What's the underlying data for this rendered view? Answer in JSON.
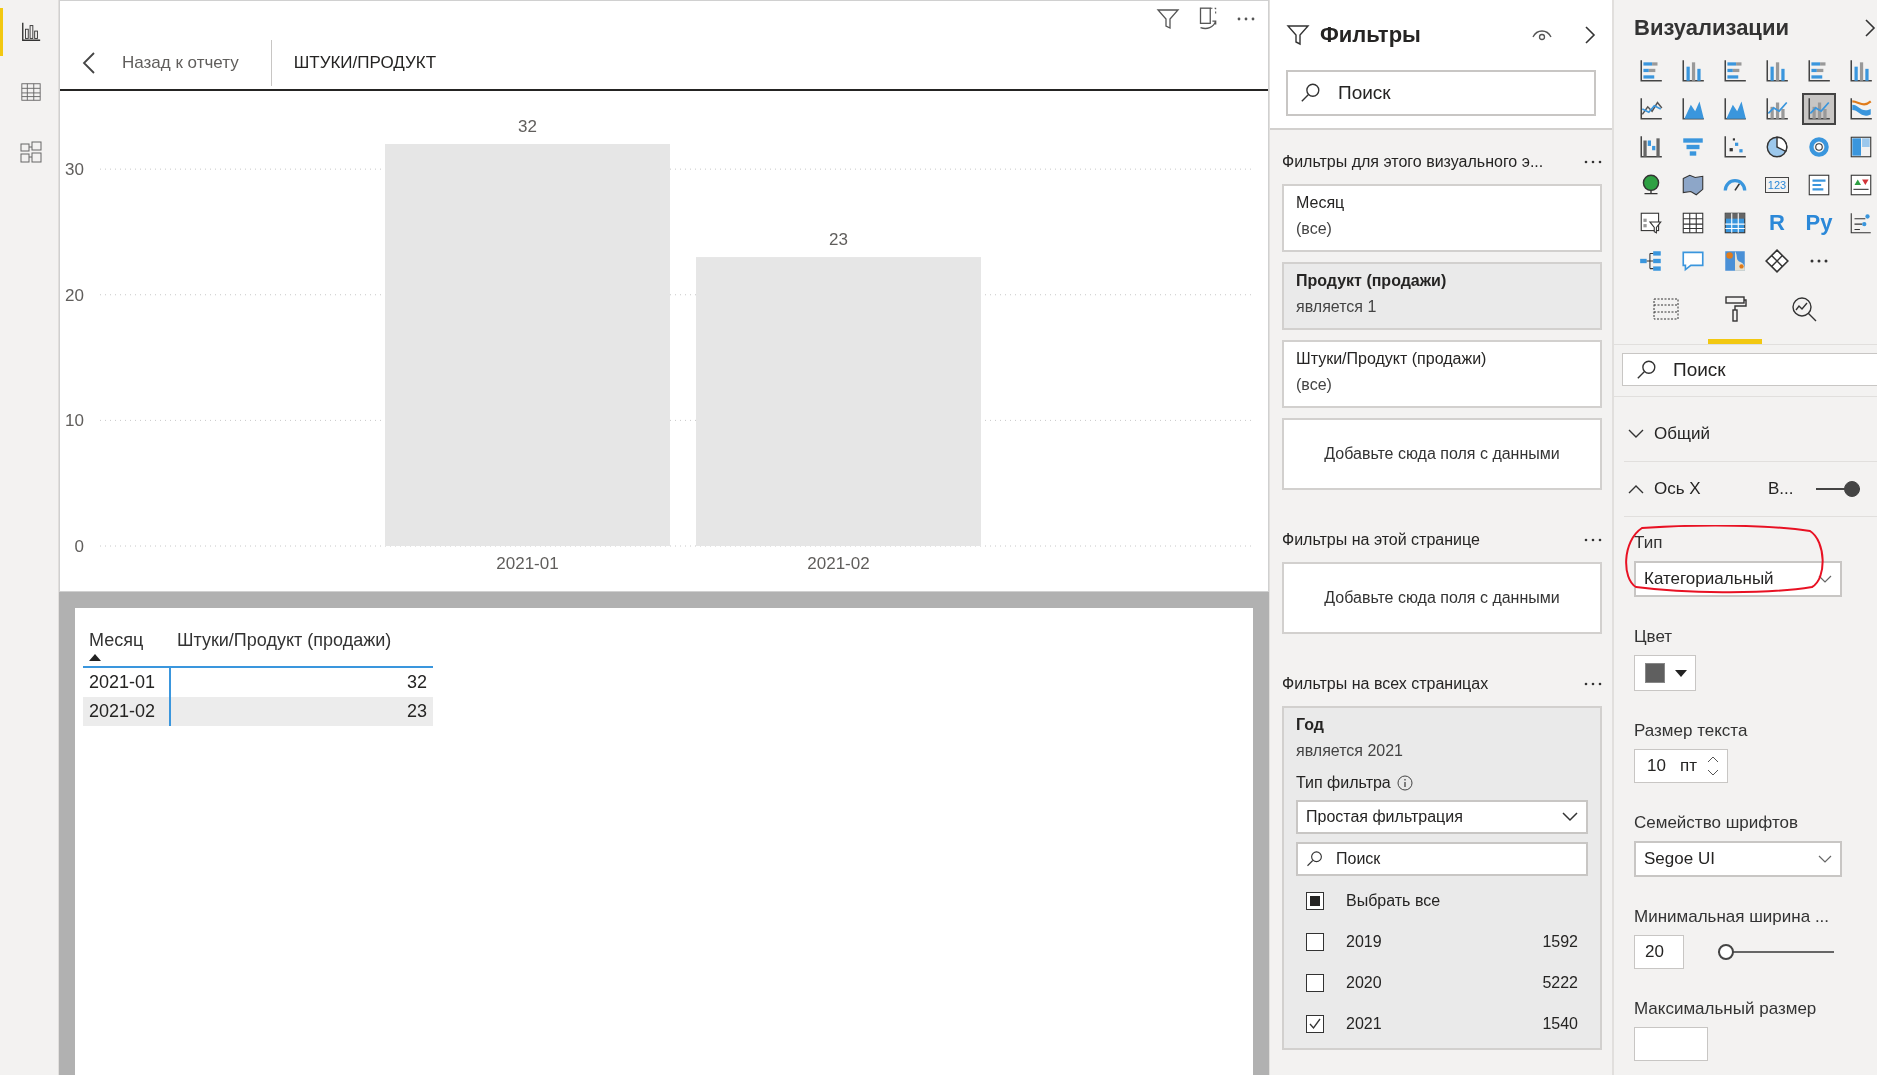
{
  "nav_rail": {
    "items": [
      {
        "selected": true
      },
      {
        "selected": false
      },
      {
        "selected": false
      }
    ]
  },
  "report": {
    "back_label": "Назад к отчету",
    "title": "ШТУКИ/ПРОДУКТ",
    "chart_data": {
      "type": "bar",
      "categories": [
        "2021-01",
        "2021-02"
      ],
      "values": [
        32,
        23
      ],
      "yticks": [
        0,
        10,
        20,
        30
      ],
      "ylim": [
        0,
        32
      ],
      "data_labels": true,
      "grid": true
    },
    "table": {
      "columns": [
        {
          "label": "Месяц",
          "sorted": true
        },
        {
          "label": "Штуки/Продукт (продажи)",
          "sorted": false
        }
      ],
      "rows": [
        [
          "2021-01",
          "32"
        ],
        [
          "2021-02",
          "23"
        ]
      ]
    }
  },
  "filters": {
    "title": "Фильтры",
    "search": {
      "placeholder": "Поиск"
    },
    "sections": [
      {
        "title": "Фильтры для этого визуального э...",
        "cards": [
          {
            "kind": "filter",
            "title": "Месяц",
            "summary": "(все)",
            "applied": false,
            "expanded": false
          },
          {
            "kind": "filter",
            "title": "Продукт (продажи)",
            "summary": "является 1",
            "applied": true,
            "expanded": false
          },
          {
            "kind": "filter",
            "title": "Штуки/Продукт (продажи)",
            "summary": "(все)",
            "applied": false,
            "expanded": false
          },
          {
            "kind": "dropzone",
            "label": "Добавьте сюда поля с данными"
          }
        ]
      },
      {
        "title": "Фильтры на этой странице",
        "cards": [
          {
            "kind": "dropzone",
            "label": "Добавьте сюда поля с данными"
          }
        ]
      },
      {
        "title": "Фильтры на всех страницах",
        "cards": [
          {
            "kind": "filter",
            "title": "Год",
            "summary": "является 2021",
            "applied": true,
            "expanded": true,
            "filter_type_label": "Тип фильтра",
            "filter_type": "Простая фильтрация",
            "search_placeholder": "Поиск",
            "items": [
              {
                "label": "Выбрать все",
                "partial": true
              },
              {
                "label": "2019",
                "count": "1592",
                "checked": false
              },
              {
                "label": "2020",
                "count": "5222",
                "checked": false
              },
              {
                "label": "2021",
                "count": "1540",
                "checked": true
              }
            ]
          }
        ]
      }
    ]
  },
  "visualizations": {
    "title": "Визуализации",
    "gallery": [
      {
        "kind": "icon",
        "selected": false
      },
      {
        "kind": "icon",
        "selected": false
      },
      {
        "kind": "icon",
        "selected": false
      },
      {
        "kind": "icon",
        "selected": false
      },
      {
        "kind": "icon",
        "selected": false
      },
      {
        "kind": "icon",
        "selected": false
      },
      {
        "kind": "icon",
        "selected": false
      },
      {
        "kind": "icon",
        "selected": false
      },
      {
        "kind": "icon",
        "selected": false
      },
      {
        "kind": "icon",
        "selected": false
      },
      {
        "kind": "icon",
        "selected": true
      },
      {
        "kind": "icon",
        "selected": false
      },
      {
        "kind": "icon",
        "selected": false
      },
      {
        "kind": "icon",
        "selected": false
      },
      {
        "kind": "icon",
        "selected": false
      },
      {
        "kind": "icon",
        "selected": false
      },
      {
        "kind": "icon",
        "selected": false
      },
      {
        "kind": "icon",
        "selected": false
      },
      {
        "kind": "icon",
        "selected": false
      },
      {
        "kind": "icon",
        "selected": false
      },
      {
        "kind": "icon",
        "selected": false
      },
      {
        "kind": "card",
        "label": "123",
        "selected": false
      },
      {
        "kind": "icon",
        "selected": false
      },
      {
        "kind": "icon",
        "selected": false
      },
      {
        "kind": "icon",
        "selected": false
      },
      {
        "kind": "icon",
        "selected": false
      },
      {
        "kind": "icon",
        "selected": false
      },
      {
        "kind": "text",
        "label": "R",
        "selected": false
      },
      {
        "kind": "text",
        "label": "Py",
        "selected": false
      },
      {
        "kind": "icon",
        "selected": false
      },
      {
        "kind": "icon",
        "selected": false
      },
      {
        "kind": "icon",
        "selected": false
      },
      {
        "kind": "icon",
        "selected": false
      },
      {
        "kind": "icon",
        "selected": false
      },
      {
        "kind": "icon",
        "selected": false
      }
    ],
    "pane_tabs": [
      {
        "selected": false
      },
      {
        "selected": true
      },
      {
        "selected": false
      }
    ],
    "format": {
      "search": {
        "placeholder": "Поиск"
      },
      "sections": [
        {
          "title": "Общий",
          "expanded": false
        },
        {
          "title": "Ось X",
          "expanded": true,
          "toggle_label": "В...",
          "on": true
        }
      ],
      "fields": [
        {
          "kind": "dropdown",
          "label": "Тип",
          "value": "Категориальный",
          "highlighted": true
        },
        {
          "kind": "color",
          "label": "Цвет",
          "color": "#5f5f5f"
        },
        {
          "kind": "spinner",
          "label": "Размер текста",
          "value": "10",
          "unit": "пт"
        },
        {
          "kind": "dropdown",
          "label": "Семейство шрифтов",
          "value": "Segoe UI",
          "highlighted": false
        },
        {
          "kind": "slider",
          "label": "Минимальная ширина ...",
          "value": "20",
          "level": 0
        },
        {
          "kind": "input",
          "label": "Максимальный размер"
        }
      ]
    }
  }
}
